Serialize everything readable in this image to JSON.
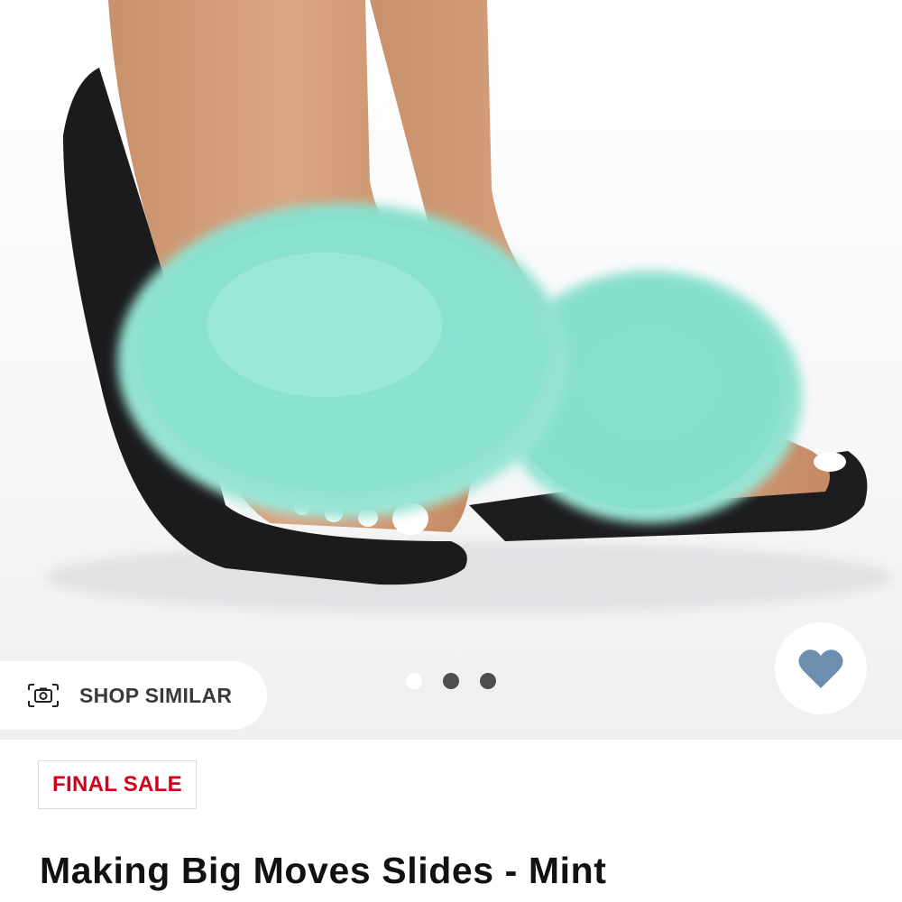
{
  "product": {
    "image_alt": "Mint fur slides worn on feet",
    "gallery": {
      "total_images": 3,
      "active_index": 0
    },
    "shop_similar": {
      "label": "SHOP SIMILAR",
      "icon": "camera-icon"
    },
    "favorite": {
      "icon": "heart-icon",
      "color": "#6c8fb0"
    },
    "badge": {
      "label": "FINAL SALE",
      "color": "#d0021b"
    },
    "title": "Making Big Moves Slides - Mint"
  }
}
